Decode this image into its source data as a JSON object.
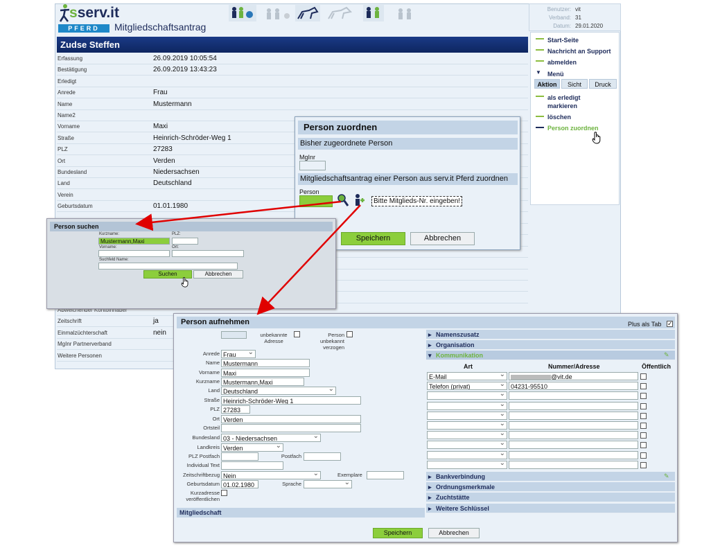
{
  "app": {
    "logo": "serv.it",
    "logo_sub": "PFERD",
    "form_title": "Mitgliedschaftsantrag"
  },
  "user": {
    "l1": "Benutzer:",
    "v1": "vit",
    "l2": "Verband:",
    "v2": "31",
    "l3": "Datum:",
    "v3": "29.01.2020"
  },
  "person_name": "Zudse  Steffen",
  "fields": [
    {
      "label": "Erfassung",
      "value": "26.09.2019 10:05:54"
    },
    {
      "label": "Bestätigung",
      "value": "26.09.2019 13:43:23"
    },
    {
      "label": "Erledigt",
      "value": ""
    },
    {
      "label": "Anrede",
      "value": "Frau"
    },
    {
      "label": "Name",
      "value": "Mustermann"
    },
    {
      "label": "Name2",
      "value": ""
    },
    {
      "label": "Vorname",
      "value": "Maxi"
    },
    {
      "label": "Straße",
      "value": "Heinrich-Schröder-Weg 1"
    },
    {
      "label": "PLZ",
      "value": "27283"
    },
    {
      "label": "Ort",
      "value": "Verden"
    },
    {
      "label": "Bundesland",
      "value": "Niedersachsen"
    },
    {
      "label": "Land",
      "value": "Deutschland"
    },
    {
      "label": "Verein",
      "value": ""
    },
    {
      "label": "Geburtsdatum",
      "value": "01.01.1980"
    }
  ],
  "lower_fields": [
    {
      "label": "Abweichender Kontoinhaber",
      "value": ""
    },
    {
      "label": "Zeitschrift",
      "value": "ja"
    },
    {
      "label": "Einmalzüchterschaft",
      "value": "nein"
    },
    {
      "label": "MgInr Partnerverband",
      "value": ""
    },
    {
      "label": "Weitere Personen",
      "value": ""
    }
  ],
  "sidebar": {
    "links": [
      "Start-Seite",
      "Nachricht an Support",
      "abmelden"
    ],
    "menu": "Menü",
    "tabs": [
      "Aktion",
      "Sicht",
      "Druck"
    ],
    "actions": [
      "als erledigt",
      "markieren",
      "löschen",
      "Person zuordnen"
    ]
  },
  "zuordnen": {
    "title": "Person zuordnen",
    "sec1": "Bisher zugeordnete Person",
    "mglnr": "MgInr",
    "sec2": "Mitgliedschaftsantrag einer Person aus serv.it Pferd zuordnen",
    "person": "Person",
    "hint": "Bitte Mitglieds-Nr. eingeben!",
    "save": "Speichern",
    "cancel": "Abbrechen"
  },
  "suchen": {
    "title": "Person suchen",
    "kurzname": "Kurzname:",
    "kurzname_val": "Mustermann,Maxi",
    "plz": "PLZ:",
    "vorname": "Vorname:",
    "ort": "Ort:",
    "suchfeld": "Suchfeld Name:",
    "search": "Suchen",
    "cancel": "Abbrechen"
  },
  "aufnehmen": {
    "title": "Person aufnehmen",
    "plus_tab": "Plus als Tab",
    "mglnr": "MgInr",
    "unbekannte": "unbekannte",
    "adresse": "Adresse",
    "person": "Person",
    "unbekannt": "unbekannt",
    "verzogen": "verzogen",
    "anrede": "Anrede",
    "anrede_val": "Frau",
    "name": "Name",
    "name_val": "Mustermann",
    "vorname": "Vorname",
    "vorname_val": "Maxi",
    "kurzname": "Kurzname",
    "kurzname_val": "Mustermann,Maxi",
    "land": "Land",
    "land_val": "Deutschland",
    "strasse": "Straße",
    "strasse_val": "Heinrich-Schröder-Weg 1",
    "plz": "PLZ",
    "plz_val": "27283",
    "ort": "Ort",
    "ort_val": "Verden",
    "ortsteil": "Ortsteil",
    "bundesland": "Bundesland",
    "bundesland_val": "03 - Niedersachsen",
    "landkreis": "Landkreis",
    "landkreis_val": "Verden",
    "plz_postfach": "PLZ Postfach",
    "postfach": "Postfach",
    "individual": "Individual Text",
    "zeitschrift": "Zeitschriftbezug",
    "zeitschrift_val": "Nein",
    "exemplare": "Exemplare",
    "geburtsdatum": "Geburtsdatum",
    "geburtsdatum_val": "01.02.1980",
    "sprache": "Sprache",
    "kurzadresse": "Kurzadresse",
    "veroeff": "veröffentlichen",
    "mitgliedschaft": "Mitgliedschaft",
    "save": "Speichern",
    "cancel": "Abbrechen"
  },
  "right_sections": {
    "top": [
      "Namenszusatz",
      "Organisation"
    ],
    "komm": "Kommunikation",
    "cols": [
      "Art",
      "Nummer/Adresse",
      "Öffentlich"
    ],
    "rows": [
      {
        "art": "E-Mail",
        "val": "@vit.de"
      },
      {
        "art": "Telefon (privat)",
        "val": "04231-95510"
      }
    ],
    "bottom": [
      "Bankverbindung",
      "Ordnungsmerkmale",
      "Zuchtstätte",
      "Weitere Schlüssel"
    ]
  },
  "colors": {
    "navy": "#1d2b5a",
    "green": "#8cce3c",
    "accent": "#6db33f"
  }
}
